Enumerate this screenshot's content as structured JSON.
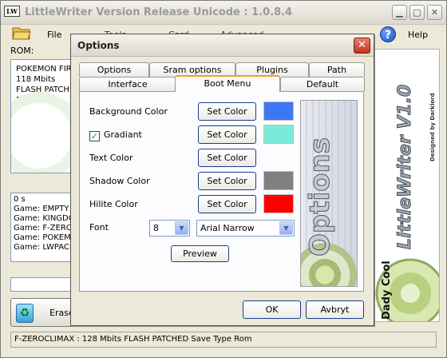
{
  "main": {
    "title": "LittleWriter Version Release Unicode : 1.0.8.4",
    "app_icon_text": "LW",
    "menu": {
      "file": "File",
      "tools": "Tools",
      "card": "Card",
      "advanced": "Advanced",
      "help": "Help"
    },
    "rom_label": "ROM:",
    "rom_info": [
      "POKEMON FIR",
      "118 Mbits",
      "FLASH PATCH",
      "Rom"
    ],
    "log": [
      "0 s",
      "Game: EMPTY",
      "Game: KINGDO",
      "Game: F-ZERO",
      "Game: POKEMO",
      "Game: LWPACK"
    ],
    "erase_label": "Erase",
    "status": "F-ZEROCLIMAX : 128 Mbits FLASH PATCHED Save Type Rom",
    "right_panel": {
      "title": "LittleWriter V1.0",
      "credit": "Designed by Darklord",
      "logo": "Dady Cool"
    }
  },
  "dialog": {
    "title": "Options",
    "close_glyph": "✕",
    "tabs_back": [
      "Options",
      "Sram options",
      "Plugins",
      "Path"
    ],
    "tabs_front": [
      "Interface",
      "Boot Menu",
      "Default"
    ],
    "active_tab": "Boot Menu",
    "rows": [
      {
        "label": "Background Color",
        "button": "Set Color",
        "swatch": "#3f76f5"
      },
      {
        "label": "Gradiant",
        "button": "Set Color",
        "swatch": "#7aebd9",
        "checked": true
      },
      {
        "label": "Text Color",
        "button": "Set Color",
        "swatch": null
      },
      {
        "label": "Shadow Color",
        "button": "Set Color",
        "swatch": "#808080"
      },
      {
        "label": "Hilite Color",
        "button": "Set Color",
        "swatch": "#ff0000"
      }
    ],
    "font_label": "Font",
    "font_size": "8",
    "font_name": "Arial Narrow",
    "preview_button": "Preview",
    "preview_image_text": "Options",
    "ok_button": "OK",
    "cancel_button": "Avbryt"
  }
}
